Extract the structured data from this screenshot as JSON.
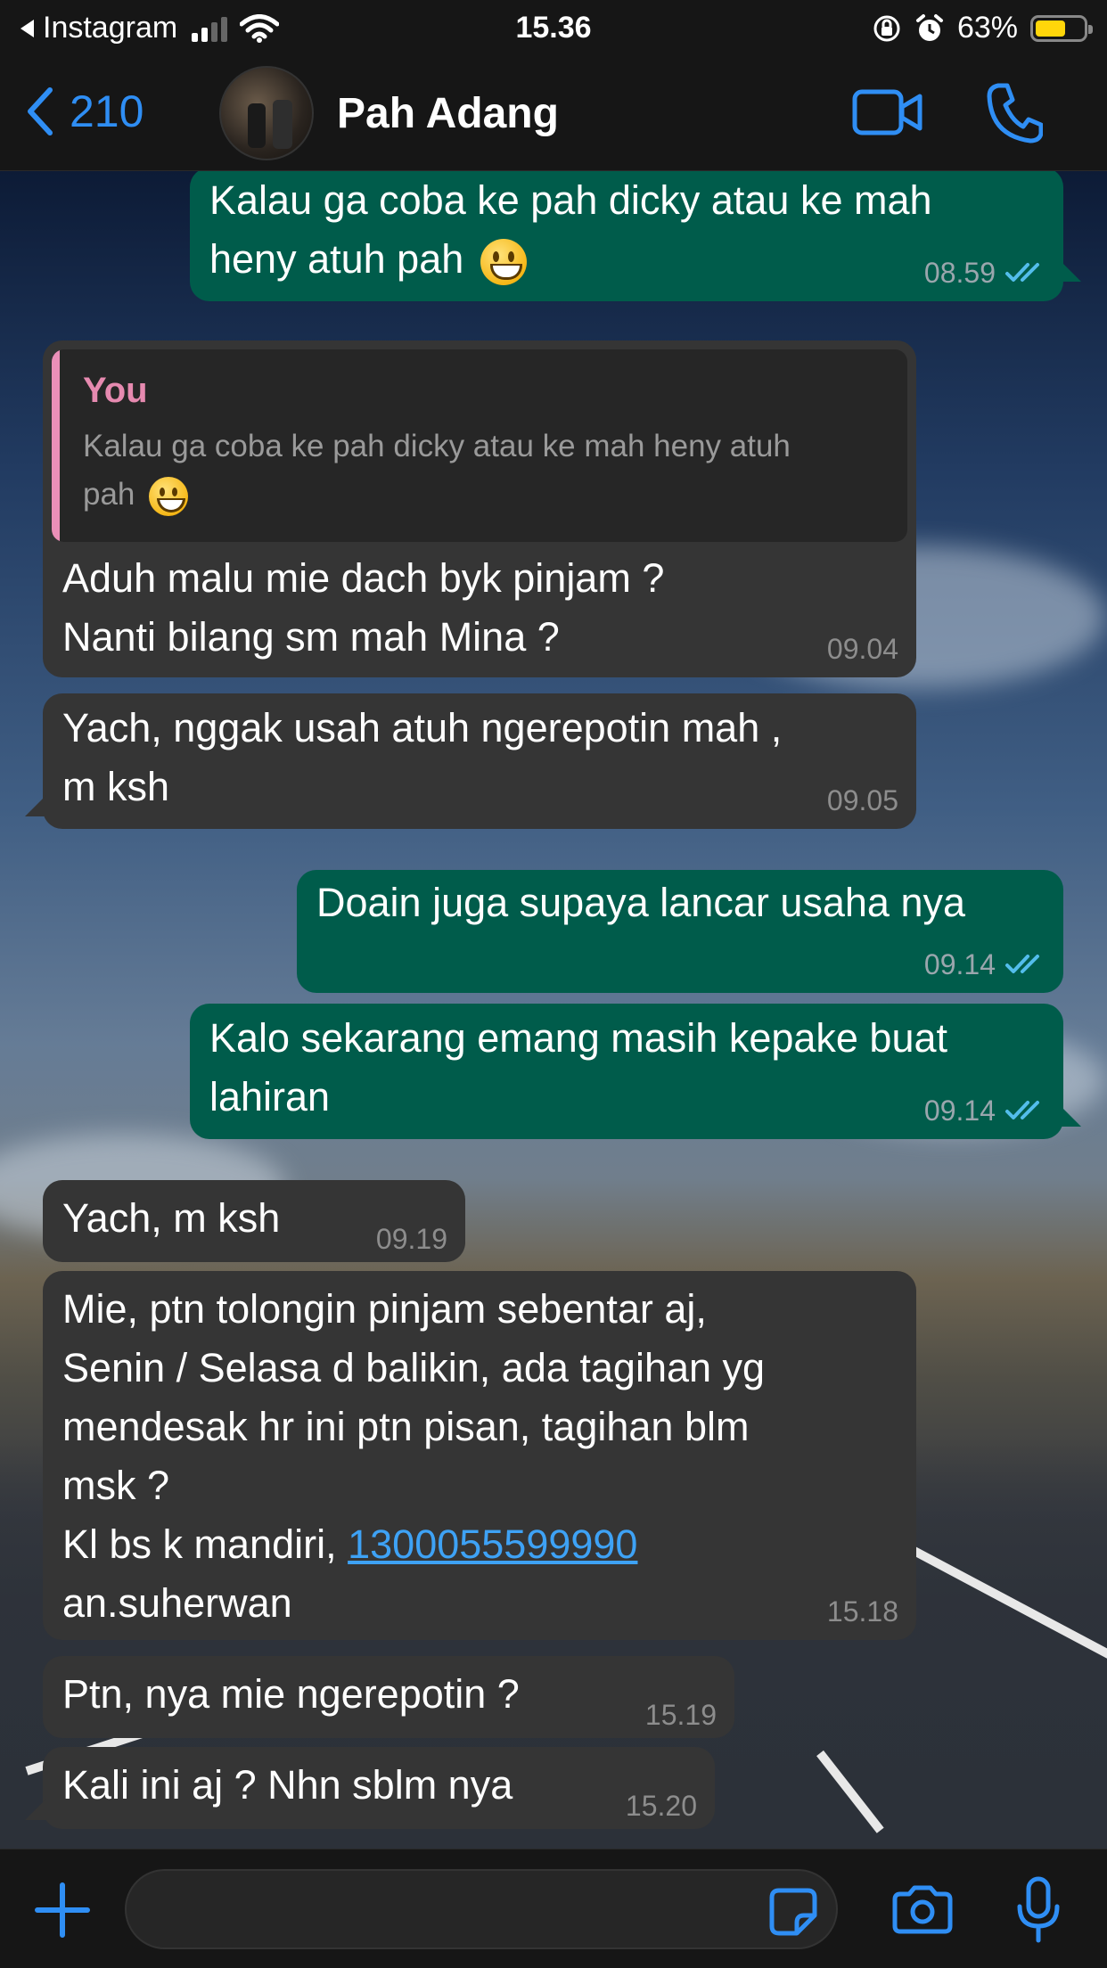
{
  "status_bar": {
    "back_app": "Instagram",
    "time": "15.36",
    "battery": "63%",
    "battery_level": 0.63,
    "accent_battery": "#ffd60a"
  },
  "header": {
    "back_count": "210",
    "contact_name": "Pah Adang",
    "icons": [
      "chevron-left-icon",
      "video-call-icon",
      "phone-call-icon"
    ],
    "accent": "#2f8ef4"
  },
  "messages": [
    {
      "dir": "out",
      "text_lines": [
        "Kalau ga coba ke pah dicky atau ke mah",
        "heny atuh pah"
      ],
      "emoji": "grinning-face",
      "time": "08.59",
      "status": "read"
    },
    {
      "dir": "in",
      "quote": {
        "name": "You",
        "text_lines": [
          "Kalau ga coba ke pah dicky atau ke mah heny atuh",
          "pah"
        ]
      },
      "text_lines": [
        "Aduh malu mie dach byk pinjam ?",
        "Nanti bilang sm mah Mina ?"
      ],
      "time": "09.04"
    },
    {
      "dir": "in",
      "text_lines": [
        "Yach, nggak usah atuh ngerepotin mah ,",
        "m ksh"
      ],
      "time": "09.05"
    },
    {
      "dir": "out",
      "text_lines": [
        "Doain juga supaya lancar usaha nya"
      ],
      "time": "09.14",
      "status": "read"
    },
    {
      "dir": "out",
      "text_lines": [
        "Kalo sekarang emang masih kepake buat",
        "lahiran"
      ],
      "time": "09.14",
      "status": "read"
    },
    {
      "dir": "in",
      "text_lines": [
        "Yach, m ksh"
      ],
      "time": "09.19"
    },
    {
      "dir": "in",
      "text_lines": [
        "Mie, ptn tolongin pinjam sebentar aj,",
        "Senin / Selasa d balikin, ada tagihan yg",
        "mendesak hr ini ptn pisan, tagihan blm",
        "msk ?"
      ],
      "link_prefix": "Kl bs k mandiri, ",
      "link": "1300055599990",
      "text_after": "an.suherwan",
      "time": "15.18"
    },
    {
      "dir": "in",
      "text_lines": [
        "Ptn, nya mie ngerepotin ?"
      ],
      "time": "15.19"
    },
    {
      "dir": "in",
      "text_lines": [
        "Kali ini aj ? Nhn sblm nya"
      ],
      "time": "15.20"
    }
  ],
  "composer": {
    "value": "",
    "placeholder": "",
    "icons": [
      "plus-icon",
      "sticker-icon",
      "camera-icon",
      "microphone-icon"
    ]
  },
  "colors": {
    "outgoing_bubble": "#005c4b",
    "incoming_bubble": "#353535",
    "read_ticks": "#53bdeb",
    "quote_author": "#e68ab0",
    "link": "#3ea2f5"
  }
}
